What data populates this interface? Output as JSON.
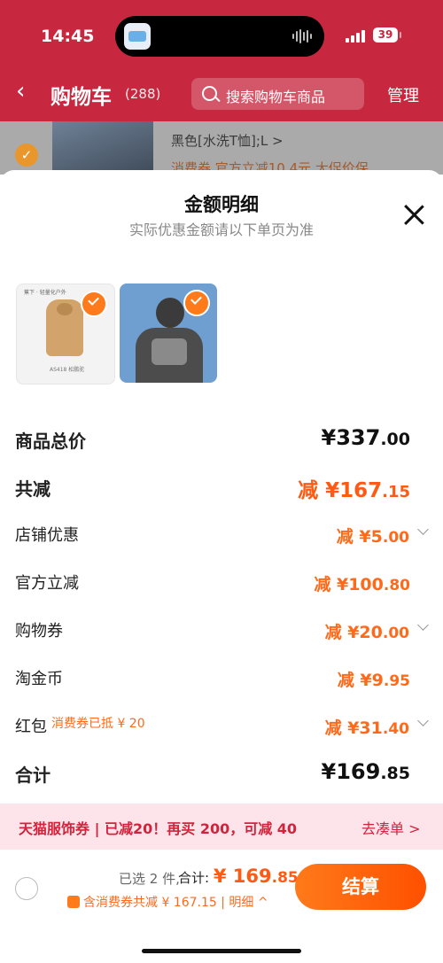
{
  "status_bar": {
    "time": "14:45",
    "battery": "39"
  },
  "header": {
    "back": "‹",
    "title": "购物车",
    "count": "(288)",
    "search_placeholder": "搜索购物车商品",
    "manage": "管理"
  },
  "cart_row": {
    "spec": "黑色[水洗T恤];L >",
    "promo": "消费券  官方立减10.4元  大促价保"
  },
  "sheet": {
    "title": "金额明细",
    "subtitle": "实际优惠金额请以下单页为准"
  },
  "products": [
    {
      "brand_tag": "蕉下 · 轻量化户外",
      "name": "AS418 松鹏驼"
    },
    {
      "image": "man-in-gray-graphic-tshirt"
    }
  ],
  "rows": {
    "subtotal": {
      "label": "商品总价",
      "prefix": "¥",
      "int": "337",
      "dec": ".00"
    },
    "total_discount": {
      "label": "共减",
      "prefix": "减 ¥",
      "int": "167",
      "dec": ".15"
    },
    "store_discount": {
      "label": "店铺优惠",
      "prefix": "减 ¥",
      "int": "5",
      "dec": ".00"
    },
    "official_discount": {
      "label": "官方立减",
      "prefix": "减 ¥",
      "int": "100",
      "dec": ".80"
    },
    "shopping_voucher": {
      "label": "购物券",
      "prefix": "减 ¥",
      "int": "20",
      "dec": ".00"
    },
    "taojinbi": {
      "label": "淘金币",
      "prefix": "减 ¥",
      "int": "9",
      "dec": ".95"
    },
    "red_packet": {
      "label": "红包",
      "note": "消费券已抵 ¥ 20",
      "prefix": "减 ¥",
      "int": "31",
      "dec": ".40"
    },
    "grand_total": {
      "label": "合计",
      "prefix": "¥",
      "int": "169",
      "dec": ".85"
    }
  },
  "banner": {
    "text": "天猫服饰券 | 已减20！再买 200，可减 40",
    "action": "去凑单 >"
  },
  "footer": {
    "selected": "已选 2 件,",
    "total_label": "合计: ",
    "total_prefix": "¥ ",
    "total_int": "169",
    "total_dec": ".85",
    "discount_note": "含消费券共减 ¥ 167.15 | 明细 ^",
    "pay_button": "结算"
  },
  "colors": {
    "brand_red": "#c8283f",
    "accent_orange": "#ff5a14",
    "banner_bg": "#fde4ea"
  }
}
